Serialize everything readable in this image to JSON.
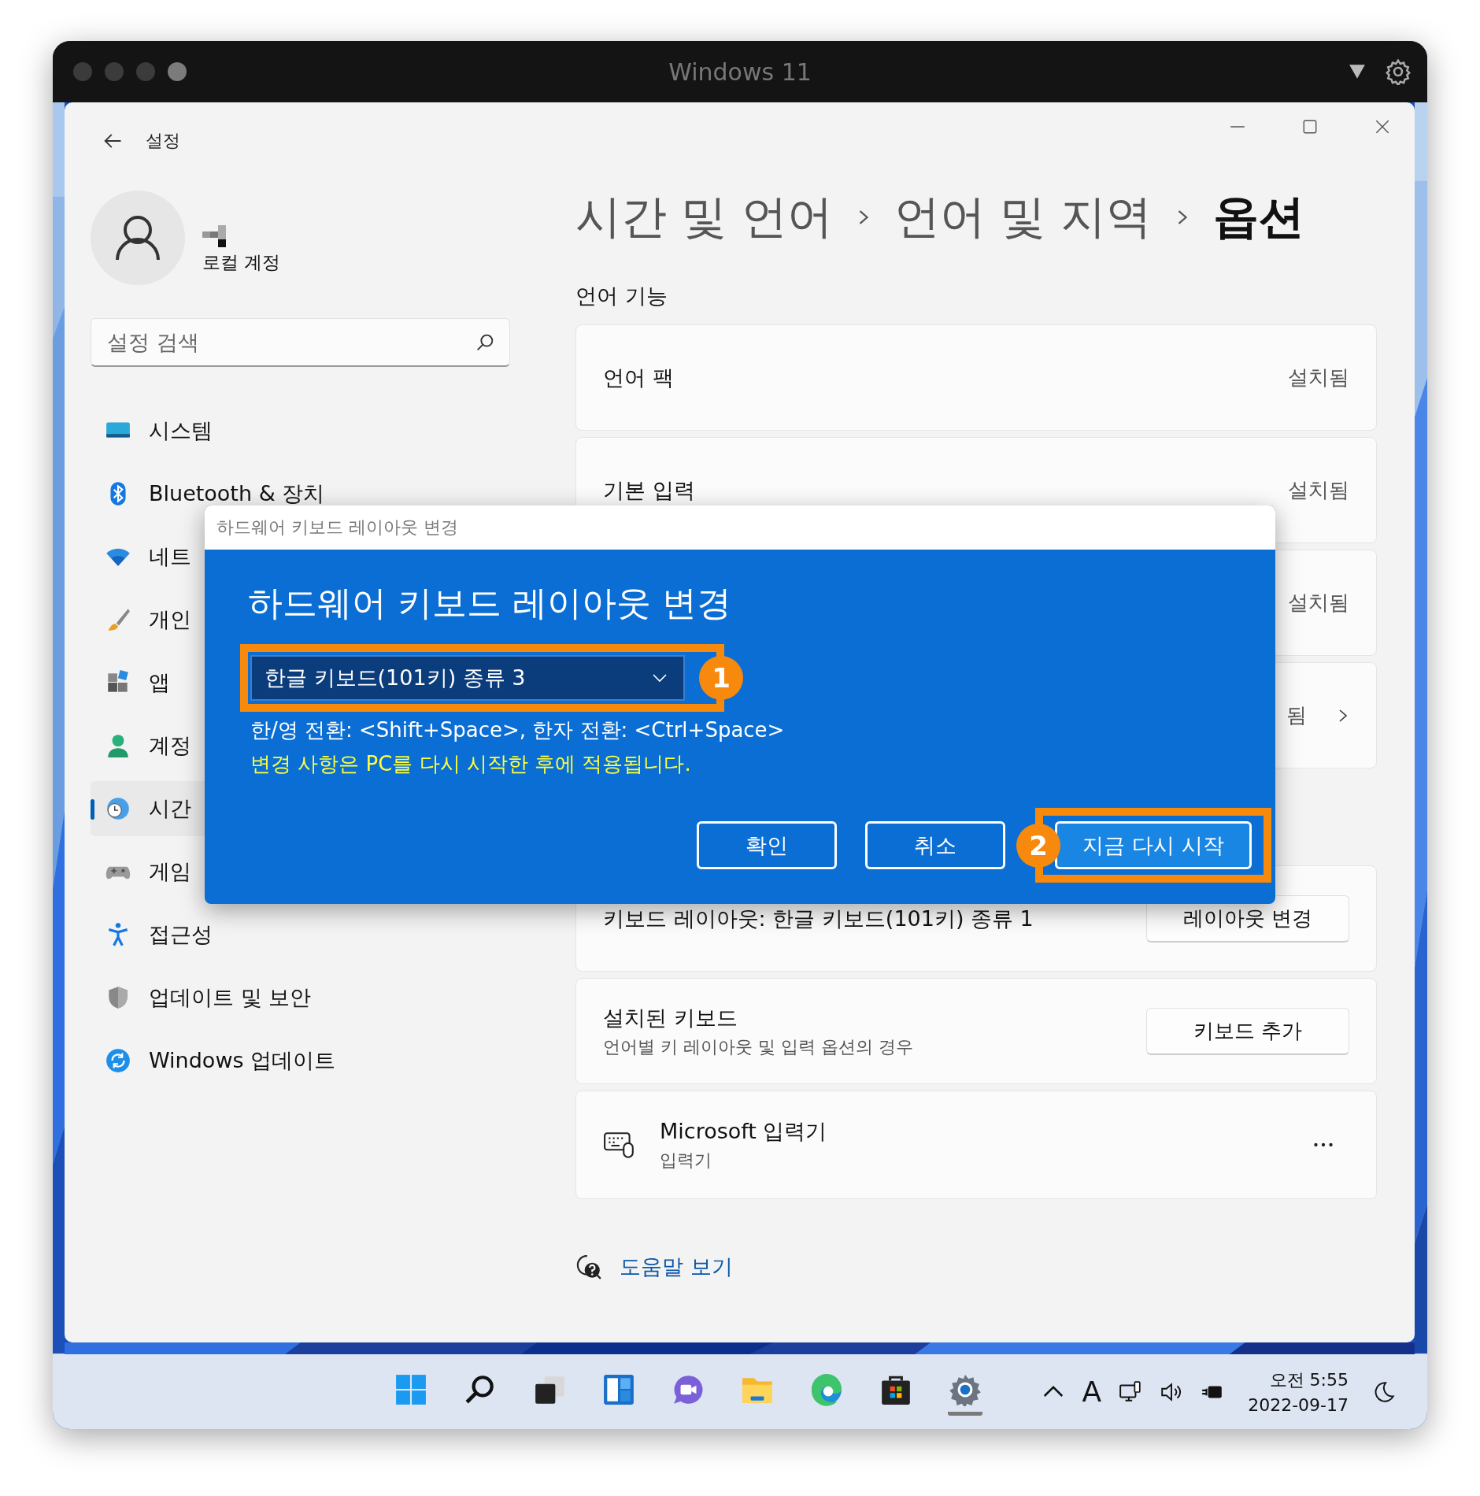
{
  "host_window": {
    "title": "Windows 11"
  },
  "settings": {
    "title": "설정",
    "account": {
      "label": "로컬 계정"
    },
    "search": {
      "placeholder": "설정 검색"
    },
    "nav": [
      {
        "label": "시스템",
        "selected": false
      },
      {
        "label": "Bluetooth & 장치",
        "selected": false
      },
      {
        "label": "네트",
        "selected": false
      },
      {
        "label": "개인",
        "selected": false
      },
      {
        "label": "앱",
        "selected": false
      },
      {
        "label": "계정",
        "selected": false
      },
      {
        "label": "시간",
        "selected": true
      },
      {
        "label": "게임",
        "selected": false
      },
      {
        "label": "접근성",
        "selected": false
      },
      {
        "label": "업데이트 및 보안",
        "selected": false
      },
      {
        "label": "Windows 업데이트",
        "selected": false
      }
    ],
    "breadcrumb": [
      "시간 및 언어",
      "언어 및 지역",
      "옵션"
    ],
    "section_title": "언어 기능",
    "cards": [
      {
        "kind": "status",
        "title": "언어 팩",
        "status": "설치됨"
      },
      {
        "kind": "status",
        "title": "기본 입력",
        "status": "설치됨"
      },
      {
        "kind": "status",
        "status": "설치됨"
      },
      {
        "kind": "link",
        "status": "됨"
      },
      {
        "kind": "button",
        "title": "키보드 레이아웃: 한글 키보드(101키) 종류 1",
        "button": "레이아웃 변경"
      },
      {
        "kind": "button",
        "title": "설치된 키보드",
        "subtitle": "언어별 키 레이아웃 및 입력 옵션의 경우",
        "button": "키보드 추가"
      },
      {
        "kind": "app",
        "title": "Microsoft 입력기",
        "subtitle": "입력기"
      }
    ],
    "help_link": "도움말 보기"
  },
  "dialog": {
    "caption": "하드웨어 키보드 레이아웃 변경",
    "heading": "하드웨어 키보드 레이아웃 변경",
    "dropdown": {
      "value": "한글 키보드(101키) 종류 3"
    },
    "info": "한/영 전환: <Shift+Space>, 한자 전환: <Ctrl+Space>",
    "notice": "변경 사항은 PC를 다시 시작한 후에 적용됩니다.",
    "buttons": [
      {
        "label": "확인",
        "kind": "default"
      },
      {
        "label": "취소",
        "kind": "default"
      },
      {
        "label": "지금 다시 시작",
        "kind": "primary"
      }
    ]
  },
  "annotations": [
    {
      "label": "1"
    },
    {
      "label": "2"
    }
  ],
  "taskbar": {
    "apps": [
      {
        "running": false
      },
      {
        "running": false
      },
      {
        "running": false
      },
      {
        "running": false
      },
      {
        "running": false
      },
      {
        "running": false
      },
      {
        "running": false
      },
      {
        "running": false
      },
      {
        "running": true
      }
    ],
    "input_indicator": "A",
    "time": "오전 5:55",
    "date": "2022-09-17"
  }
}
